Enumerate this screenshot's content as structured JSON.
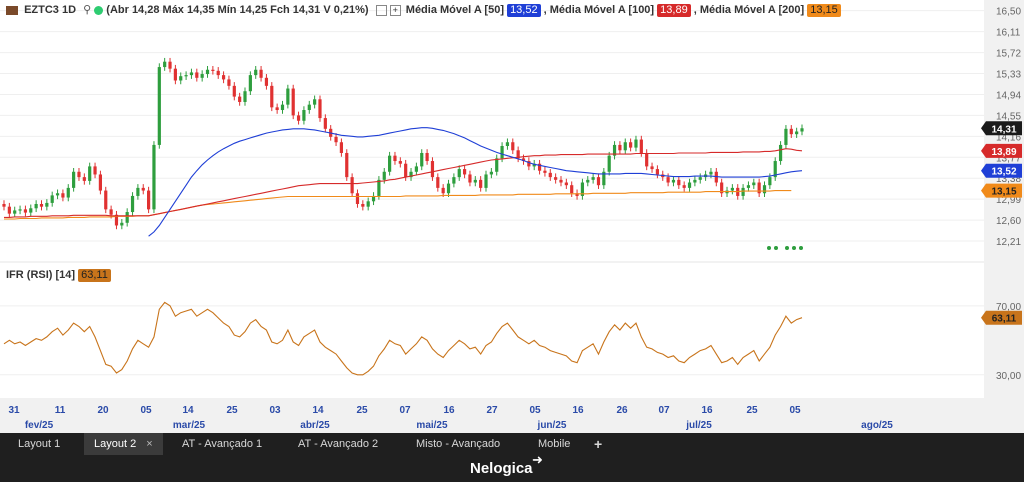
{
  "header": {
    "symbol": "EZTC3 1D",
    "quote": "(Abr 14,28 Máx 14,35 Mín 14,25 Fch 14,31 V 0,21%)",
    "ma50_label": "Média Móvel A [50]",
    "ma50_value": "13,52",
    "ma100_label": ", Média Móvel A [100]",
    "ma100_value": "13,89",
    "ma200_label": ", Média Móvel A [200]",
    "ma200_value": "13,15"
  },
  "rsi_panel": {
    "label": "IFR (RSI) [14]",
    "value": "63,11"
  },
  "colors": {
    "up": "#2e9e3e",
    "down": "#e03131",
    "ma50": "#1f3fd6",
    "ma100": "#d62a2a",
    "ma200": "#f08a1a",
    "rsi": "#c8741b",
    "price_tag": "#1a1a1a"
  },
  "tabs": [
    {
      "label": "Layout 1",
      "active": false
    },
    {
      "label": "Layout 2",
      "active": true,
      "close": "×"
    },
    {
      "label": "AT - Avançado 1",
      "active": false
    },
    {
      "label": "AT - Avançado 2",
      "active": false
    },
    {
      "label": "Misto - Avançado",
      "active": false
    },
    {
      "label": "Mobile",
      "active": false
    },
    {
      "label": "+",
      "active": false
    }
  ],
  "brand": "Nelogica",
  "chart_data": {
    "type": "candlestick",
    "price_axis": {
      "ticks": [
        "16,50",
        "16,11",
        "15,72",
        "15,33",
        "14,94",
        "14,55",
        "14,16",
        "13,77",
        "13,38",
        "12,99",
        "12,60",
        "12,21"
      ],
      "range": [
        11.95,
        16.55
      ]
    },
    "rsi_axis": {
      "ticks": [
        "70,00",
        "30,00"
      ],
      "range": [
        20,
        85
      ]
    },
    "value_tags": {
      "close": "14,31",
      "ma100": "13,89",
      "ma50": "13,52",
      "ma200": "13,15",
      "rsi": "63,11"
    },
    "x_day_labels": [
      "31",
      "11",
      "20",
      "05",
      "14",
      "25",
      "03",
      "14",
      "25",
      "07",
      "16",
      "27",
      "05",
      "16",
      "26",
      "07",
      "16",
      "25",
      "05"
    ],
    "x_month_labels": [
      "fev/25",
      "mar/25",
      "abr/25",
      "mai/25",
      "jun/25",
      "jul/25",
      "ago/25"
    ],
    "closes": [
      12.85,
      12.72,
      12.78,
      12.8,
      12.74,
      12.82,
      12.9,
      12.85,
      12.92,
      13.06,
      13.1,
      13.02,
      13.2,
      13.5,
      13.4,
      13.33,
      13.6,
      13.45,
      13.15,
      12.8,
      12.7,
      12.5,
      12.55,
      12.75,
      13.05,
      13.2,
      13.15,
      12.8,
      14.0,
      15.45,
      15.55,
      15.42,
      15.2,
      15.28,
      15.3,
      15.35,
      15.25,
      15.32,
      15.4,
      15.38,
      15.3,
      15.22,
      15.1,
      14.9,
      14.8,
      15.0,
      15.3,
      15.4,
      15.25,
      15.1,
      14.7,
      14.65,
      14.75,
      15.05,
      14.55,
      14.45,
      14.65,
      14.75,
      14.85,
      14.5,
      14.3,
      14.15,
      14.05,
      13.85,
      13.4,
      13.1,
      12.9,
      12.85,
      12.95,
      13.05,
      13.35,
      13.5,
      13.8,
      13.7,
      13.65,
      13.4,
      13.5,
      13.6,
      13.85,
      13.7,
      13.4,
      13.2,
      13.1,
      13.28,
      13.4,
      13.55,
      13.45,
      13.3,
      13.35,
      13.2,
      13.45,
      13.5,
      13.75,
      13.98,
      14.05,
      13.9,
      13.75,
      13.7,
      13.6,
      13.65,
      13.52,
      13.48,
      13.4,
      13.35,
      13.3,
      13.25,
      13.1,
      13.05,
      13.3,
      13.35,
      13.4,
      13.25,
      13.5,
      13.8,
      14.0,
      13.9,
      14.05,
      13.95,
      14.1,
      13.85,
      13.6,
      13.55,
      13.45,
      13.4,
      13.3,
      13.35,
      13.25,
      13.2,
      13.3,
      13.35,
      13.4,
      13.45,
      13.5,
      13.3,
      13.1,
      13.15,
      13.2,
      13.05,
      13.2,
      13.25,
      13.3,
      13.1,
      13.25,
      13.4,
      13.7,
      14.0,
      14.3,
      14.2,
      14.25,
      14.31
    ],
    "ma50": [
      null,
      null,
      null,
      null,
      null,
      null,
      null,
      null,
      null,
      null,
      null,
      null,
      null,
      null,
      null,
      null,
      null,
      null,
      null,
      null,
      null,
      null,
      null,
      null,
      null,
      null,
      null,
      12.3,
      12.38,
      12.5,
      12.65,
      12.8,
      12.95,
      13.1,
      13.25,
      13.4,
      13.52,
      13.63,
      13.72,
      13.8,
      13.87,
      13.93,
      13.98,
      14.03,
      14.07,
      14.1,
      14.13,
      14.16,
      14.19,
      14.22,
      14.24,
      14.26,
      14.28,
      14.29,
      14.3,
      14.3,
      14.3,
      14.29,
      14.28,
      14.26,
      14.24,
      14.22,
      14.2,
      14.18,
      14.17,
      14.16,
      14.15,
      14.15,
      14.16,
      14.17,
      14.18,
      14.2,
      14.22,
      14.24,
      14.26,
      14.28,
      14.3,
      14.31,
      14.32,
      14.32,
      14.31,
      14.29,
      14.27,
      14.24,
      14.21,
      14.17,
      14.13,
      14.08,
      14.03,
      13.98,
      13.94,
      13.9,
      13.86,
      13.83,
      13.8,
      13.77,
      13.74,
      13.71,
      13.67,
      13.64,
      13.62,
      13.6,
      13.58,
      13.56,
      13.54,
      13.52,
      13.51,
      13.5,
      13.49,
      13.48,
      13.47,
      13.46,
      13.46,
      13.46,
      13.46,
      13.46,
      13.47,
      13.47,
      13.47,
      13.47,
      13.46,
      13.45,
      13.44,
      13.43,
      13.42,
      13.41,
      13.41,
      13.41,
      13.41,
      13.42,
      13.42,
      13.42,
      13.42,
      13.41,
      13.4,
      13.4,
      13.4,
      13.4,
      13.4,
      13.4,
      13.4,
      13.4,
      13.41,
      13.42,
      13.44,
      13.46,
      13.48,
      13.5,
      13.51,
      13.52
    ],
    "ma100": [
      12.65,
      12.65,
      12.66,
      12.66,
      12.66,
      12.67,
      12.67,
      12.67,
      12.67,
      12.68,
      12.68,
      12.68,
      12.68,
      12.69,
      12.69,
      12.69,
      12.69,
      12.69,
      12.69,
      12.69,
      12.68,
      12.68,
      12.68,
      12.68,
      12.68,
      12.68,
      12.68,
      12.68,
      12.7,
      12.72,
      12.74,
      12.76,
      12.78,
      12.8,
      12.82,
      12.84,
      12.86,
      12.88,
      12.9,
      12.92,
      12.94,
      12.96,
      12.98,
      13.0,
      13.02,
      13.04,
      13.06,
      13.08,
      13.1,
      13.12,
      13.14,
      13.16,
      13.18,
      13.2,
      13.22,
      13.24,
      13.25,
      13.26,
      13.27,
      13.28,
      13.28,
      13.28,
      13.28,
      13.28,
      13.28,
      13.28,
      13.28,
      13.29,
      13.3,
      13.31,
      13.32,
      13.33,
      13.35,
      13.36,
      13.38,
      13.4,
      13.42,
      13.44,
      13.46,
      13.48,
      13.5,
      13.52,
      13.54,
      13.56,
      13.58,
      13.6,
      13.62,
      13.64,
      13.66,
      13.68,
      13.7,
      13.72,
      13.73,
      13.74,
      13.75,
      13.76,
      13.77,
      13.78,
      13.79,
      13.8,
      13.8,
      13.81,
      13.81,
      13.81,
      13.82,
      13.82,
      13.82,
      13.82,
      13.82,
      13.83,
      13.83,
      13.83,
      13.83,
      13.83,
      13.83,
      13.83,
      13.83,
      13.83,
      13.84,
      13.84,
      13.84,
      13.84,
      13.84,
      13.84,
      13.84,
      13.84,
      13.85,
      13.85,
      13.85,
      13.85,
      13.85,
      13.85,
      13.86,
      13.86,
      13.86,
      13.86,
      13.86,
      13.86,
      13.87,
      13.87,
      13.87,
      13.87,
      13.88,
      13.88,
      13.89,
      13.91,
      13.93,
      13.92,
      13.9,
      13.89
    ],
    "ma200": [
      12.62,
      12.62,
      12.62,
      12.63,
      12.63,
      12.63,
      12.63,
      12.64,
      12.64,
      12.64,
      12.64,
      12.64,
      12.65,
      12.65,
      12.65,
      12.65,
      12.66,
      12.66,
      12.66,
      12.66,
      12.66,
      12.67,
      12.67,
      12.67,
      12.67,
      12.68,
      12.68,
      12.68,
      12.7,
      12.72,
      12.74,
      12.76,
      12.78,
      12.8,
      12.82,
      12.84,
      12.86,
      12.88,
      12.89,
      12.9,
      12.91,
      12.92,
      12.93,
      12.94,
      12.95,
      12.96,
      12.97,
      12.98,
      12.99,
      13.0,
      13.01,
      13.02,
      13.03,
      13.04,
      13.04,
      13.04,
      13.04,
      13.04,
      13.04,
      13.04,
      13.04,
      13.04,
      13.04,
      13.04,
      13.04,
      13.04,
      13.04,
      13.04,
      13.04,
      13.04,
      13.04,
      13.04,
      13.04,
      13.04,
      13.04,
      13.05,
      13.05,
      13.05,
      13.05,
      13.05,
      13.05,
      13.05,
      13.06,
      13.06,
      13.06,
      13.06,
      13.06,
      13.06,
      13.06,
      13.07,
      13.07,
      13.07,
      13.07,
      13.07,
      13.07,
      13.07,
      13.08,
      13.08,
      13.08,
      13.08,
      13.08,
      13.08,
      13.08,
      13.09,
      13.09,
      13.09,
      13.09,
      13.09,
      13.09,
      13.09,
      13.1,
      13.1,
      13.1,
      13.1,
      13.1,
      13.1,
      13.1,
      13.11,
      13.11,
      13.11,
      13.11,
      13.11,
      13.11,
      13.11,
      13.12,
      13.12,
      13.12,
      13.12,
      13.12,
      13.12,
      13.12,
      13.13,
      13.13,
      13.13,
      13.13,
      13.13,
      13.13,
      13.13,
      13.14,
      13.14,
      13.14,
      13.14,
      13.14,
      13.14,
      13.15,
      13.15,
      13.15,
      13.15
    ],
    "rsi": [
      48,
      50,
      48,
      49,
      47,
      49,
      51,
      50,
      52,
      55,
      57,
      53,
      56,
      60,
      58,
      55,
      58,
      52,
      44,
      36,
      35,
      31,
      33,
      38,
      45,
      50,
      48,
      46,
      52,
      68,
      72,
      70,
      64,
      66,
      67,
      68,
      64,
      66,
      68,
      66,
      63,
      60,
      58,
      53,
      52,
      55,
      60,
      62,
      58,
      56,
      49,
      48,
      50,
      56,
      49,
      47,
      52,
      54,
      56,
      49,
      46,
      44,
      42,
      38,
      34,
      31,
      30,
      30,
      32,
      35,
      41,
      45,
      50,
      48,
      47,
      42,
      45,
      48,
      52,
      50,
      45,
      42,
      40,
      44,
      47,
      50,
      48,
      45,
      46,
      42,
      47,
      49,
      54,
      58,
      60,
      56,
      52,
      50,
      48,
      50,
      47,
      46,
      44,
      43,
      42,
      41,
      38,
      37,
      44,
      46,
      48,
      42,
      49,
      55,
      59,
      56,
      60,
      57,
      60,
      52,
      46,
      45,
      43,
      42,
      40,
      41,
      38,
      37,
      40,
      42,
      44,
      45,
      47,
      42,
      37,
      38,
      40,
      36,
      40,
      42,
      44,
      38,
      42,
      46,
      53,
      58,
      64,
      60,
      62,
      63.11
    ]
  }
}
